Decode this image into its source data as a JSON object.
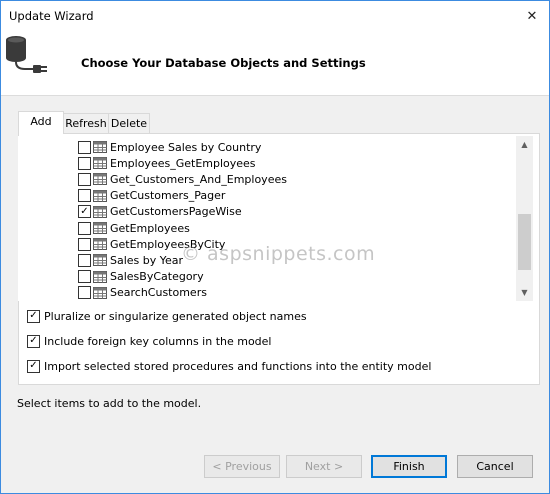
{
  "window": {
    "title": "Update Wizard",
    "close_glyph": "✕"
  },
  "header": {
    "title": "Choose Your Database Objects and Settings",
    "icon": "database-plug-icon"
  },
  "tabs": [
    {
      "label": "Add",
      "active": true
    },
    {
      "label": "Refresh",
      "active": false
    },
    {
      "label": "Delete",
      "active": false
    }
  ],
  "objects": [
    {
      "label": "Employee Sales by Country",
      "checked": false
    },
    {
      "label": "Employees_GetEmployees",
      "checked": false
    },
    {
      "label": "Get_Customers_And_Employees",
      "checked": false
    },
    {
      "label": "GetCustomers_Pager",
      "checked": false
    },
    {
      "label": "GetCustomersPageWise",
      "checked": true
    },
    {
      "label": "GetEmployees",
      "checked": false
    },
    {
      "label": "GetEmployeesByCity",
      "checked": false
    },
    {
      "label": "Sales by Year",
      "checked": false
    },
    {
      "label": "SalesByCategory",
      "checked": false
    },
    {
      "label": "SearchCustomers",
      "checked": false
    }
  ],
  "options": [
    {
      "label": "Pluralize or singularize generated object names",
      "checked": true
    },
    {
      "label": "Include foreign key columns in the model",
      "checked": true
    },
    {
      "label": "Import selected stored procedures and functions into the entity model",
      "checked": true
    }
  ],
  "status": "Select items to add to the model.",
  "watermark": "© aspsnippets.com",
  "buttons": {
    "previous": "< Previous",
    "next": "Next >",
    "finish": "Finish",
    "cancel": "Cancel"
  },
  "scrollbar": {
    "up_glyph": "▲",
    "down_glyph": "▼"
  },
  "colors": {
    "accent": "#0078d7",
    "window_border": "#3c8be0"
  }
}
